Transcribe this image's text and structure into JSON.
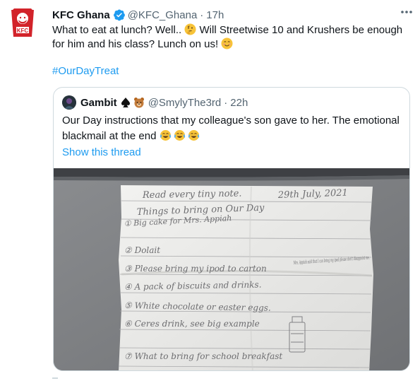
{
  "tweet": {
    "display_name": "KFC Ghana",
    "handle": "@KFC_Ghana",
    "separator": "·",
    "time": "17h",
    "text_1": "What to eat at lunch? Well.. ",
    "text_2": " Will Streetwise 10 and Krushers be enough for him and his class? Lunch on us! ",
    "hashtag": "#OurDayTreat",
    "avatar_brand": "KFC",
    "icons": [
      "kfc-logo",
      "verified-badge",
      "more-options-icon",
      "thinking-face-emoji",
      "smiling-face-emoji"
    ]
  },
  "quote": {
    "display_name": "Gambit",
    "handle": "@SmylyThe3rd",
    "separator": "·",
    "time": "22h",
    "text": "Our Day instructions that my colleague's son gave to her. The emotional blackmail at the end ",
    "show_thread": "Show this thread",
    "icons": [
      "spade-suit-emoji",
      "bear-face-emoji",
      "tears-of-joy-emoji"
    ]
  },
  "note": {
    "header": "Read every tiny note.",
    "date": "29th July, 2021",
    "title": "Things to bring on Our Day",
    "items": [
      "① Big cake for Mrs. Appiah",
      "② Dolait",
      "③ Please bring my ipod to carton",
      "④ A pack of biscuits and drinks.",
      "⑤ White chocolate or easter eggs.",
      "⑥ Ceres drink, see big example",
      "⑦ What to bring for school breakfast"
    ],
    "side_note": "Mrs. Appiah said that I can bring my ipod please don't disappoint me."
  },
  "colors": {
    "text": "#0f1419",
    "secondary": "#536471",
    "link": "#1d9bf0",
    "border": "#cfd9de",
    "brand_red": "#d2232a"
  }
}
